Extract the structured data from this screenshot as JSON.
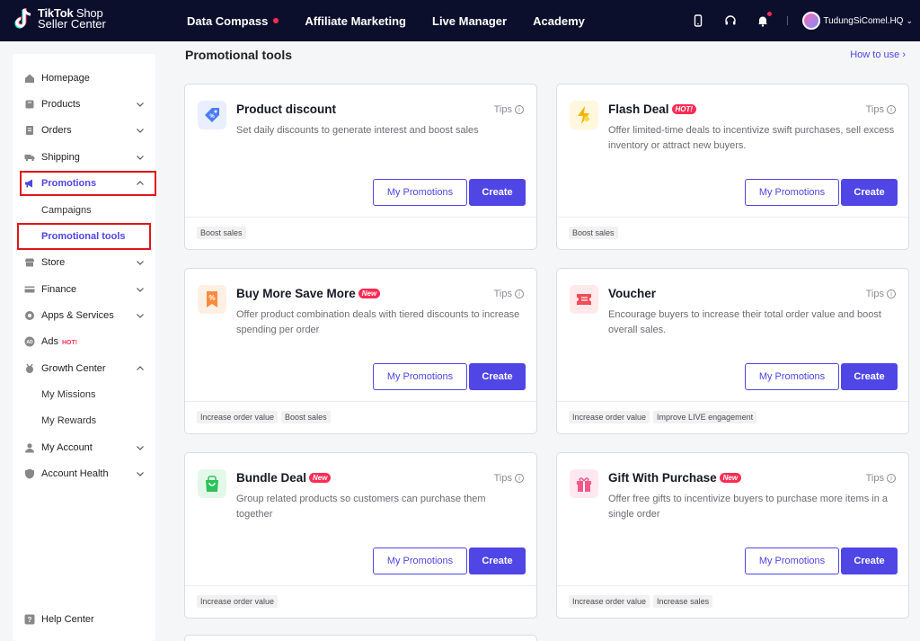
{
  "app": {
    "logo_line1_bold": "TikTok",
    "logo_line1_thin": "Shop",
    "logo_line2": "Seller Center"
  },
  "nav": {
    "items": [
      {
        "label": "Data Compass",
        "has_dot": true
      },
      {
        "label": "Affiliate Marketing"
      },
      {
        "label": "Live Manager"
      },
      {
        "label": "Academy"
      }
    ],
    "username": "TudungSiComel.HQ",
    "colors": {
      "bar": "#0b0f2c",
      "dot": "#fe2c55"
    }
  },
  "sidebar": {
    "items": [
      {
        "label": "Homepage",
        "icon": "home-icon"
      },
      {
        "label": "Products",
        "icon": "products-icon"
      },
      {
        "label": "Orders",
        "icon": "orders-icon"
      },
      {
        "label": "Shipping",
        "icon": "truck-icon"
      },
      {
        "label": "Promotions",
        "icon": "megaphone-icon",
        "active": true
      },
      {
        "label": "Campaigns"
      },
      {
        "label": "Promotional tools",
        "active": true
      },
      {
        "label": "Store",
        "icon": "store-icon"
      },
      {
        "label": "Finance",
        "icon": "card-icon"
      },
      {
        "label": "Apps & Services",
        "icon": "apps-icon"
      },
      {
        "label": "Ads",
        "icon": "ad-icon",
        "badge": "HOT!"
      },
      {
        "label": "Growth Center",
        "icon": "medal-icon"
      },
      {
        "label": "My Missions"
      },
      {
        "label": "My Rewards"
      },
      {
        "label": "My Account",
        "icon": "user-icon"
      },
      {
        "label": "Account Health",
        "icon": "shield-icon"
      },
      {
        "label": "Help Center",
        "icon": "help-icon"
      }
    ]
  },
  "main": {
    "title": "Promotional tools",
    "how_to_use": "How to use",
    "tips_label": "Tips",
    "my_promotions_label": "My Promotions",
    "create_label": "Create",
    "accent_color": "#4f46e5",
    "cards": [
      {
        "title": "Product discount",
        "badge": "",
        "desc": "Set daily discounts to generate interest and boost sales",
        "tags": [
          "Boost sales"
        ],
        "icon": "discount-tag-icon"
      },
      {
        "title": "Flash Deal",
        "badge": "HOT!",
        "desc": "Offer limited-time deals to incentivize swift purchases, sell excess inventory or attract new buyers.",
        "tags": [
          "Boost sales"
        ],
        "icon": "lightning-icon"
      },
      {
        "title": "Buy More Save More",
        "badge": "New",
        "desc": "Offer product combination deals with tiered discounts to increase spending per order",
        "tags": [
          "Increase order value",
          "Boost sales"
        ],
        "icon": "percent-bookmark-icon"
      },
      {
        "title": "Voucher",
        "badge": "",
        "desc": "Encourage buyers to increase their total order value and boost overall sales.",
        "tags": [
          "Increase order value",
          "Improve LIVE engagement"
        ],
        "icon": "voucher-icon"
      },
      {
        "title": "Bundle Deal",
        "badge": "New",
        "desc": "Group related products so customers can purchase them together",
        "tags": [
          "Increase order value"
        ],
        "icon": "shopping-bag-icon"
      },
      {
        "title": "Gift With Purchase",
        "badge": "New",
        "desc": "Offer free gifts to incentivize buyers to purchase more items in a single order",
        "tags": [
          "Increase order value",
          "Increase sales"
        ],
        "icon": "gift-icon"
      }
    ]
  }
}
